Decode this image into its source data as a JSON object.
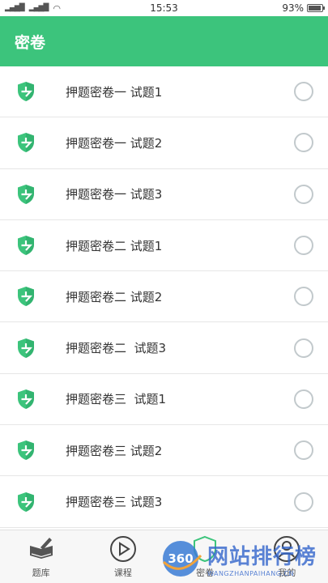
{
  "status_bar": {
    "signal_left": "4G",
    "time": "15:53",
    "battery": "93%",
    "battery_level": 0.93
  },
  "app_bar": {
    "title": "密卷"
  },
  "list": {
    "items": [
      {
        "label": "押题密卷一 试题1",
        "selected": false
      },
      {
        "label": "押题密卷一 试题2",
        "selected": false
      },
      {
        "label": "押题密卷一 试题3",
        "selected": false
      },
      {
        "label": "押题密卷二 试题1",
        "selected": false
      },
      {
        "label": "押题密卷二 试题2",
        "selected": false
      },
      {
        "label": "押题密卷二  试题3",
        "selected": false
      },
      {
        "label": "押题密卷三  试题1",
        "selected": false
      },
      {
        "label": "押题密卷三 试题2",
        "selected": false
      },
      {
        "label": "押题密卷三 试题3",
        "selected": false
      }
    ]
  },
  "bottom_nav": {
    "items": [
      {
        "label": "题库",
        "icon": "book-pen-icon"
      },
      {
        "label": "课程",
        "icon": "play-circle-icon"
      },
      {
        "label": "密卷",
        "icon": "shield-icon"
      },
      {
        "label": "我的",
        "icon": "user-icon"
      }
    ]
  },
  "watermark": {
    "logo_text": "360",
    "main": "网站排行榜",
    "sub": "WANGZHANPAIHANG.CN"
  },
  "colors": {
    "accent": "#3cc47c",
    "radio_border": "#c2c9cc",
    "divider": "#e6e6e6"
  }
}
